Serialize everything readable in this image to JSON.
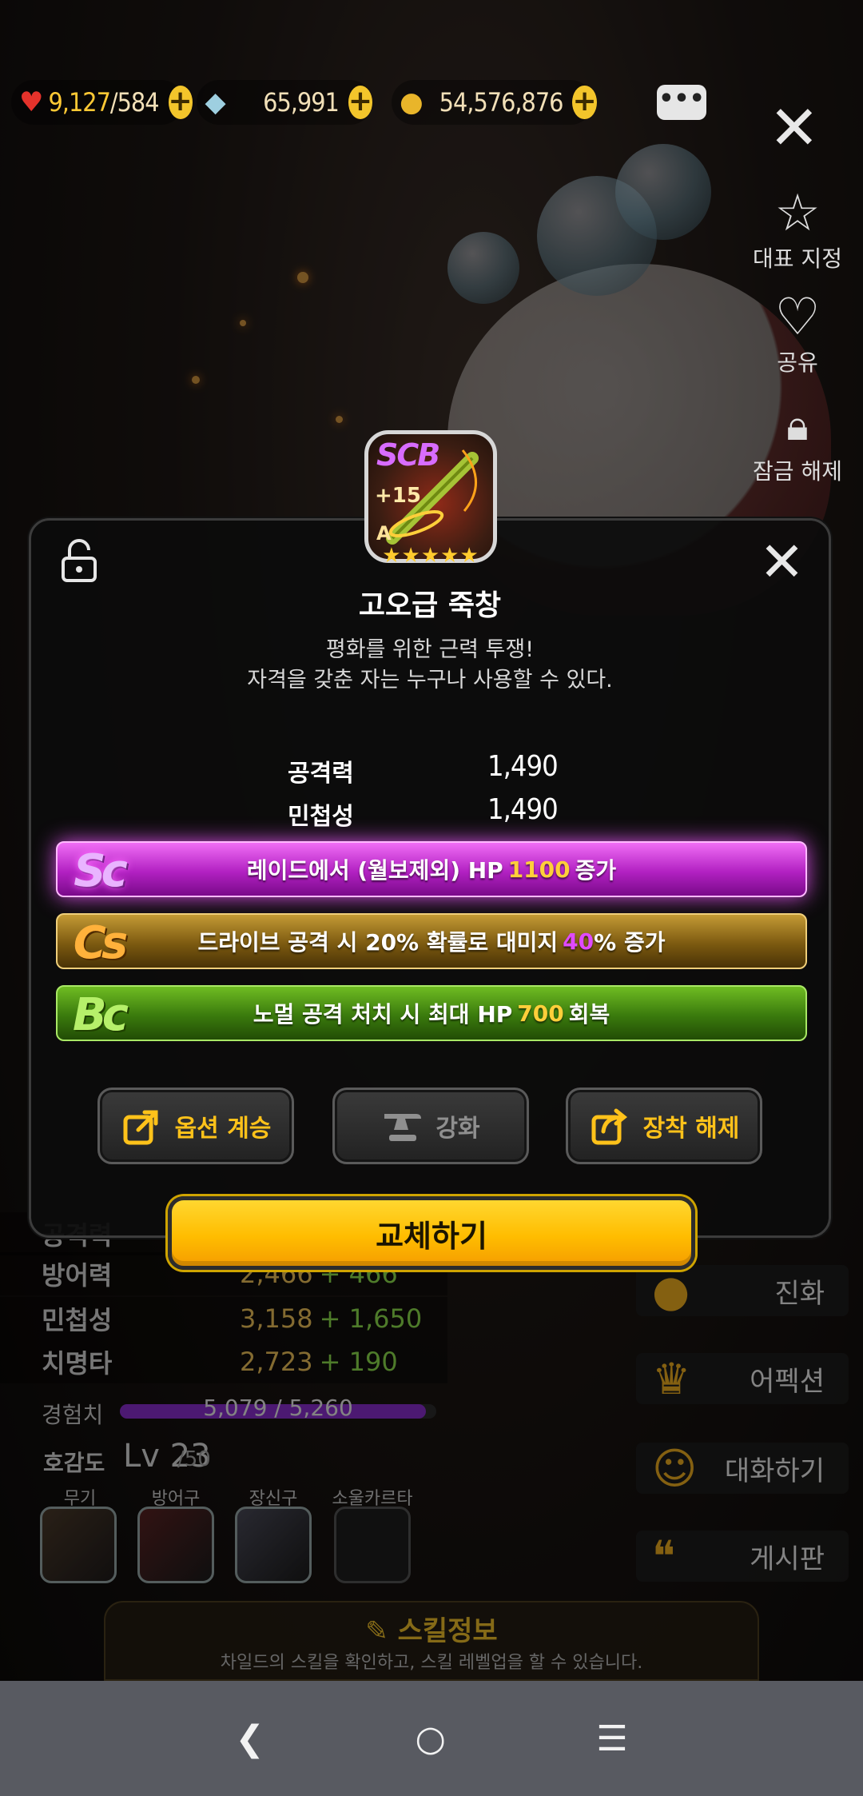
{
  "topbar": {
    "hearts": {
      "current": "9,127",
      "max": "/584"
    },
    "gems": "65,991",
    "gold": "54,576,876",
    "plus": "+"
  },
  "side_buttons": {
    "representative": "대표 지정",
    "share": "공유",
    "unlock": "잠금 해제"
  },
  "background": {
    "stats": [
      {
        "label": "공격력",
        "value": "",
        "bonus": ""
      },
      {
        "label": "방어력",
        "value": "2,466",
        "bonus": "+ 466"
      },
      {
        "label": "민첩성",
        "value": "3,158",
        "bonus": "+ 1,650"
      },
      {
        "label": "치명타",
        "value": "2,723",
        "bonus": "+ 190"
      }
    ],
    "exp_label": "경험치",
    "exp_value": "5,079 / 5,260",
    "exp_fraction": 0.966,
    "affection_label": "호감도",
    "affection_level": "Lv 23",
    "affection_max": "/50",
    "equip_caps": [
      "무기",
      "방어구",
      "장신구",
      "소울카르타"
    ],
    "menu": [
      "진화",
      "어펙션",
      "대화하기",
      "게시판"
    ],
    "skill_title": "스킬정보",
    "skill_desc": "차일드의 스킬을 확인하고, 스킬 레벨업을 할 수 있습니다."
  },
  "item": {
    "grade": "SCB",
    "enhance": "+15",
    "rank": "A",
    "stars": "★★★★★",
    "name": "고오급 죽창",
    "desc_line1": "평화를 위한 근력 투쟁!",
    "desc_line2": "자격을 갖춘 자는 누구나 사용할 수 있다.",
    "stats": [
      {
        "label": "공격력",
        "value": "1,490"
      },
      {
        "label": "민첩성",
        "value": "1,490"
      }
    ]
  },
  "options": [
    {
      "badge": "Sc",
      "pre": "레이드에서 (월보제외) HP",
      "hl": "1100",
      "post": "증가",
      "color": "#ffcf3a"
    },
    {
      "badge": "Cs",
      "pre": "드라이브 공격 시 20% 확률로 대미지",
      "hl": "40",
      "post": "% 증가",
      "color": "#e04aff"
    },
    {
      "badge": "Bc",
      "pre": "노멀 공격 처치 시 최대 HP",
      "hl": "700",
      "post": "회복",
      "color": "#ffcf3a"
    }
  ],
  "actions": {
    "inherit": "옵션 계승",
    "enhance": "강화",
    "unequip": "장착 해제",
    "replace": "교체하기"
  },
  "colors": {
    "accent": "#ffc21a",
    "option_sc": "#b221c2",
    "option_cs": "#7c5a10",
    "option_bc": "#3a7a0d"
  }
}
